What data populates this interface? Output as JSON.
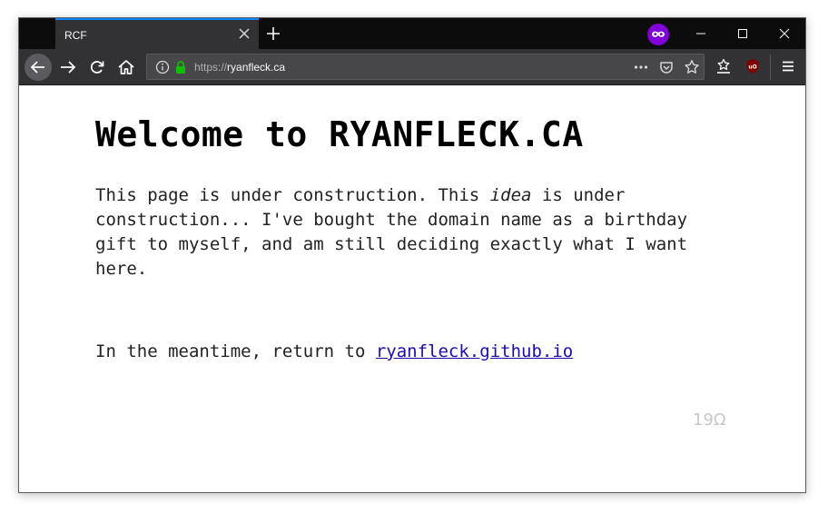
{
  "browser": {
    "tab_title": "RCF",
    "url_scheme": "https://",
    "url_host": "ryanfleck.ca"
  },
  "page": {
    "heading": "Welcome to RYANFLECK.CA",
    "para_part1": "This page is under construction. This ",
    "para_emphasis": "idea",
    "para_part2": " is under construction... I've bought the domain name as a birthday gift to myself, and am still deciding exactly what I want here.",
    "meantime_text": "In the meantime, return to ",
    "link_text": "ryanfleck.github.io",
    "footer_mark": "19Ω"
  },
  "colors": {
    "tab_accent": "#0a84ff",
    "private_badge": "#8000d7",
    "lock_green": "#12bc00",
    "ublock_red": "#800000",
    "link": "#1a0dab"
  },
  "icons": [
    "close-icon",
    "plus-icon",
    "private-browsing-icon",
    "minimize-icon",
    "maximize-icon",
    "window-close-icon",
    "back-arrow-icon",
    "forward-arrow-icon",
    "reload-icon",
    "home-icon",
    "info-icon",
    "lock-icon",
    "page-actions-icon",
    "pocket-icon",
    "bookmark-star-icon",
    "library-icon",
    "ublock-icon",
    "hamburger-menu-icon"
  ]
}
